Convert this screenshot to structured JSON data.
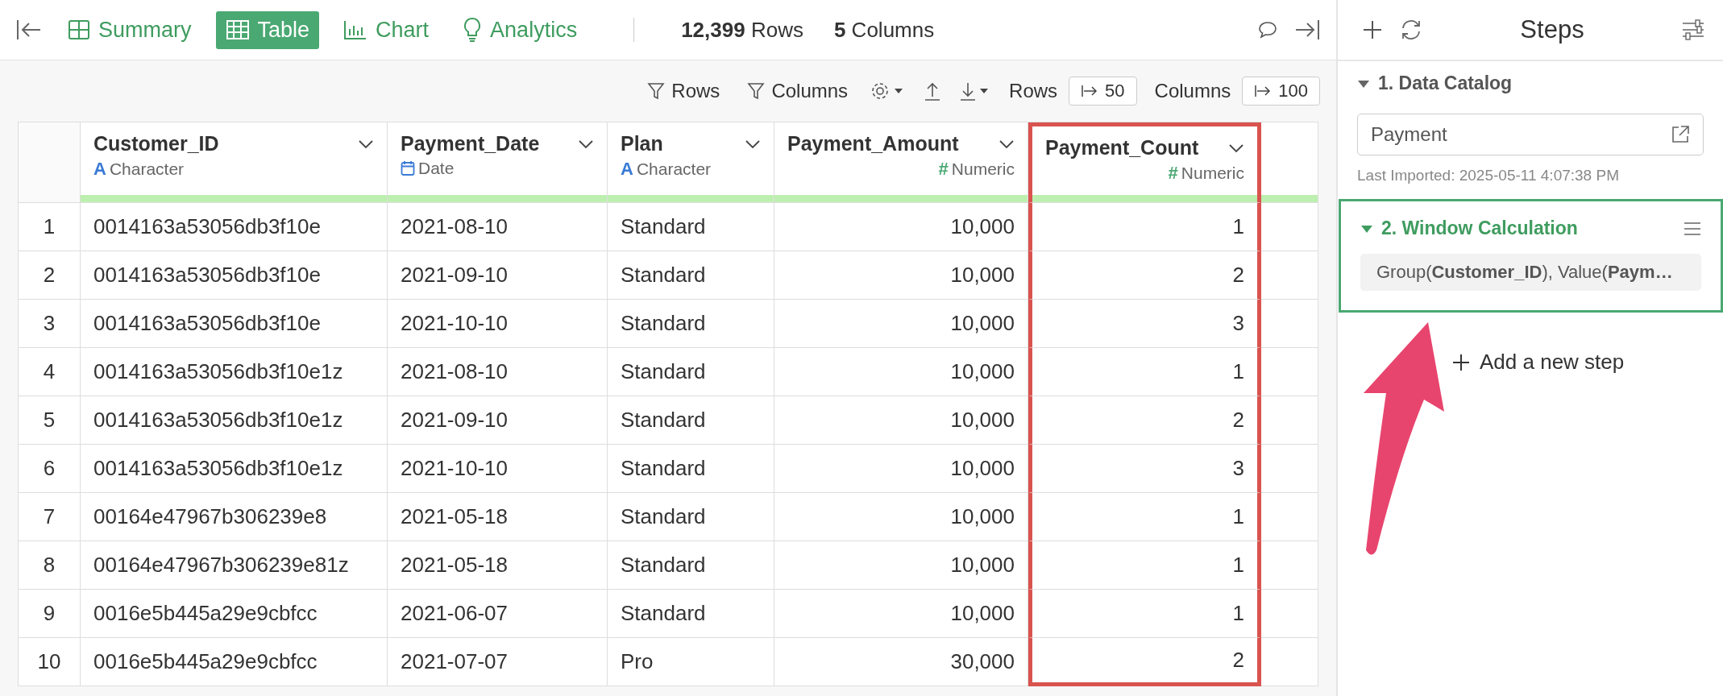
{
  "topbar": {
    "tabs": [
      {
        "label": "Summary",
        "selected": false
      },
      {
        "label": "Table",
        "selected": true
      },
      {
        "label": "Chart",
        "selected": false
      },
      {
        "label": "Analytics",
        "selected": false
      }
    ],
    "row_count": "**12,399** Rows",
    "column_count": "**5** Columns"
  },
  "toolbar": {
    "filters": [
      "Rows",
      "Columns"
    ],
    "rows_label": "Rows",
    "rows_value": "50",
    "columns_label": "Columns",
    "columns_value": "100"
  },
  "table": {
    "columns": [
      {
        "name": "Customer_ID",
        "kind": "character",
        "type_icon": "A",
        "type_label": "Character",
        "highlighted": false
      },
      {
        "name": "Payment_Date",
        "kind": "date",
        "type_label": "Date",
        "highlighted": false
      },
      {
        "name": "Plan",
        "kind": "character",
        "type_icon": "A",
        "type_label": "Character",
        "highlighted": false
      },
      {
        "name": "Payment_Amount",
        "kind": "numeric",
        "type_icon": "#",
        "type_label": "Numeric",
        "highlighted": false
      },
      {
        "name": "Payment_Count",
        "kind": "numeric",
        "type_icon": "#",
        "type_label": "Numeric",
        "highlighted": true
      }
    ],
    "rows": [
      {
        "index": "1",
        "cells": [
          "0014163a53056db3f10e",
          "2021-08-10",
          "Standard",
          "10,000",
          "1"
        ]
      },
      {
        "index": "2",
        "cells": [
          "0014163a53056db3f10e",
          "2021-09-10",
          "Standard",
          "10,000",
          "2"
        ]
      },
      {
        "index": "3",
        "cells": [
          "0014163a53056db3f10e",
          "2021-10-10",
          "Standard",
          "10,000",
          "3"
        ]
      },
      {
        "index": "4",
        "cells": [
          "0014163a53056db3f10e1z",
          "2021-08-10",
          "Standard",
          "10,000",
          "1"
        ]
      },
      {
        "index": "5",
        "cells": [
          "0014163a53056db3f10e1z",
          "2021-09-10",
          "Standard",
          "10,000",
          "2"
        ]
      },
      {
        "index": "6",
        "cells": [
          "0014163a53056db3f10e1z",
          "2021-10-10",
          "Standard",
          "10,000",
          "3"
        ]
      },
      {
        "index": "7",
        "cells": [
          "00164e47967b306239e8",
          "2021-05-18",
          "Standard",
          "10,000",
          "1"
        ]
      },
      {
        "index": "8",
        "cells": [
          "00164e47967b306239e81z",
          "2021-05-18",
          "Standard",
          "10,000",
          "1"
        ]
      },
      {
        "index": "9",
        "cells": [
          "0016e5b445a29e9cbfcc",
          "2021-06-07",
          "Standard",
          "10,000",
          "1"
        ]
      },
      {
        "index": "10",
        "cells": [
          "0016e5b445a29e9cbfcc",
          "2021-07-07",
          "Pro",
          "30,000",
          "2"
        ]
      }
    ]
  },
  "sidebar": {
    "title": "Steps",
    "steps": [
      {
        "kind": "data_catalog",
        "title": "1. Data Catalog",
        "expanded": true,
        "selected": false,
        "source": "Payment",
        "note": "Last Imported: 2025-05-11 4:07:38 PM"
      },
      {
        "kind": "calculation",
        "title": "2. Window Calculation",
        "expanded": true,
        "selected": true,
        "summary": "Group(**Customer_ID**), Value(**Paym…**"
      }
    ],
    "add_step": "Add a new step"
  }
}
